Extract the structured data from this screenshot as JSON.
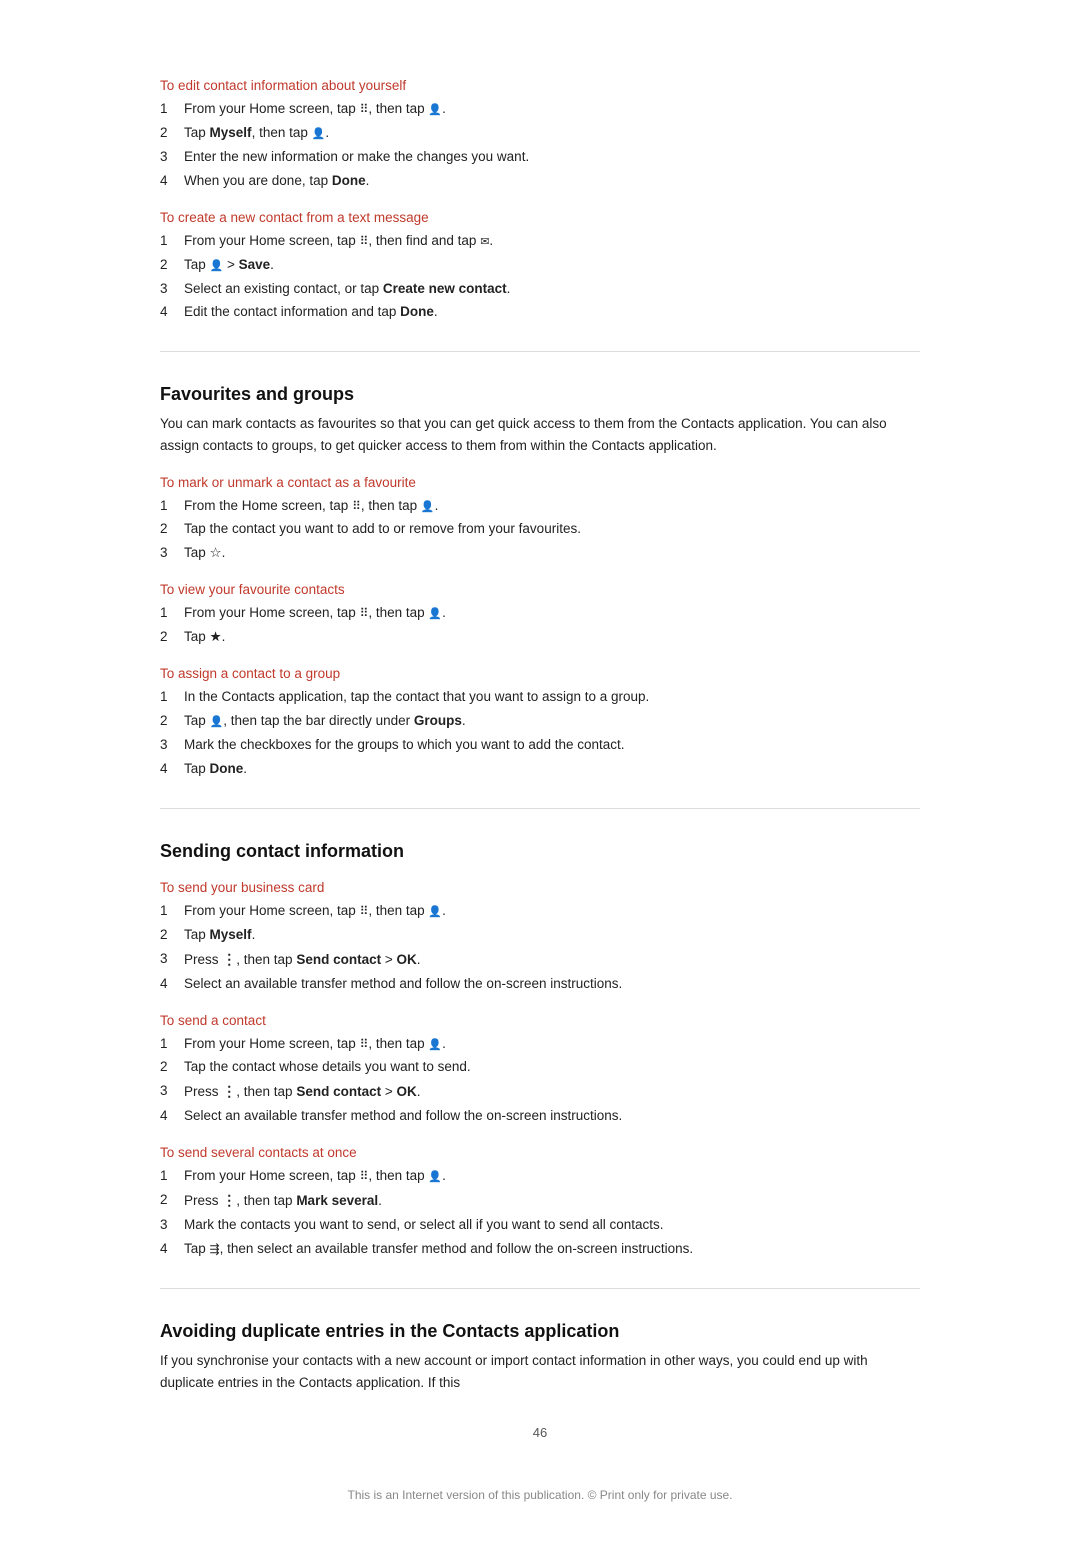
{
  "page": {
    "number": "46",
    "footer": "This is an Internet version of this publication. © Print only for private use."
  },
  "sections": {
    "edit_contact": {
      "heading": "To edit contact information about yourself",
      "steps": [
        {
          "num": "1",
          "text": "From your Home screen, tap ",
          "bold_parts": [],
          "suffix": ", then tap ",
          "icon1": "grid",
          "icon2": "person"
        },
        {
          "num": "2",
          "text": "Tap Myself, then tap ",
          "icon": "person-edit"
        },
        {
          "num": "3",
          "text": "Enter the new information or make the changes you want."
        },
        {
          "num": "4",
          "text": "When you are done, tap Done."
        }
      ]
    },
    "create_from_text": {
      "heading": "To create a new contact from a text message",
      "steps": [
        {
          "num": "1",
          "text": "From your Home screen, tap ",
          "suffix": ", then find and tap ",
          "icon1": "grid",
          "icon2": "msg"
        },
        {
          "num": "2",
          "text": "Tap  > Save."
        },
        {
          "num": "3",
          "text": "Select an existing contact, or tap Create new contact."
        },
        {
          "num": "4",
          "text": "Edit the contact information and tap Done."
        }
      ]
    },
    "favourites_groups": {
      "heading": "Favourites and groups",
      "description": "You can mark contacts as favourites so that you can get quick access to them from the Contacts application. You can also assign contacts to groups, to get quicker access to them from within the Contacts application.",
      "subsections": {
        "mark_favourite": {
          "heading": "To mark or unmark a contact as a favourite",
          "steps": [
            {
              "num": "1",
              "text": "From the Home screen, tap , then tap ."
            },
            {
              "num": "2",
              "text": "Tap the contact you want to add to or remove from your favourites."
            },
            {
              "num": "3",
              "text": "Tap ☆."
            }
          ]
        },
        "view_favourite": {
          "heading": "To view your favourite contacts",
          "steps": [
            {
              "num": "1",
              "text": "From your Home screen, tap , then tap ."
            },
            {
              "num": "2",
              "text": "Tap ★."
            }
          ]
        },
        "assign_group": {
          "heading": "To assign a contact to a group",
          "steps": [
            {
              "num": "1",
              "text": "In the Contacts application, tap the contact that you want to assign to a group."
            },
            {
              "num": "2",
              "text": "Tap , then tap the bar directly under Groups."
            },
            {
              "num": "3",
              "text": "Mark the checkboxes for the groups to which you want to add the contact."
            },
            {
              "num": "4",
              "text": "Tap Done."
            }
          ]
        }
      }
    },
    "sending_contact": {
      "heading": "Sending contact information",
      "subsections": {
        "send_business_card": {
          "heading": "To send your business card",
          "steps": [
            {
              "num": "1",
              "text": "From your Home screen, tap , then tap ."
            },
            {
              "num": "2",
              "text": "Tap Myself."
            },
            {
              "num": "3",
              "text": "Press , then tap Send contact > OK."
            },
            {
              "num": "4",
              "text": "Select an available transfer method and follow the on-screen instructions."
            }
          ]
        },
        "send_contact": {
          "heading": "To send a contact",
          "steps": [
            {
              "num": "1",
              "text": "From your Home screen, tap , then tap ."
            },
            {
              "num": "2",
              "text": "Tap the contact whose details you want to send."
            },
            {
              "num": "3",
              "text": "Press , then tap Send contact > OK."
            },
            {
              "num": "4",
              "text": "Select an available transfer method and follow the on-screen instructions."
            }
          ]
        },
        "send_several": {
          "heading": "To send several contacts at once",
          "steps": [
            {
              "num": "1",
              "text": "From your Home screen, tap , then tap ."
            },
            {
              "num": "2",
              "text": "Press , then tap Mark several."
            },
            {
              "num": "3",
              "text": "Mark the contacts you want to send, or select all if you want to send all contacts."
            },
            {
              "num": "4",
              "text": "Tap , then select an available transfer method and follow the on-screen instructions."
            }
          ]
        }
      }
    },
    "avoiding_duplicates": {
      "heading": "Avoiding duplicate entries in the Contacts application",
      "description": "If you synchronise your contacts with a new account or import contact information in other ways, you could end up with duplicate entries in the Contacts application. If this"
    }
  }
}
